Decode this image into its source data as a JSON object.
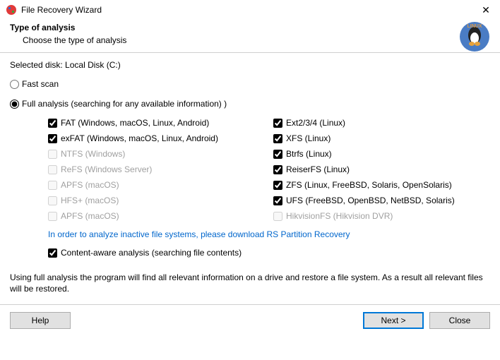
{
  "window": {
    "title": "File Recovery Wizard",
    "close_glyph": "✕"
  },
  "header": {
    "title": "Type of analysis",
    "subtitle": "Choose the type of analysis"
  },
  "selected_disk_label": "Selected disk: Local Disk (C:)",
  "scan_modes": {
    "fast_label": "Fast scan",
    "full_label": "Full analysis (searching for any available information)   )"
  },
  "filesystems": {
    "left": [
      {
        "label": "FAT (Windows, macOS, Linux, Android)",
        "checked": true,
        "disabled": false
      },
      {
        "label": "exFAT (Windows, macOS, Linux, Android)",
        "checked": true,
        "disabled": false
      },
      {
        "label": "NTFS (Windows)",
        "checked": false,
        "disabled": true
      },
      {
        "label": "ReFS (Windows Server)",
        "checked": false,
        "disabled": true
      },
      {
        "label": "APFS (macOS)",
        "checked": false,
        "disabled": true
      },
      {
        "label": "HFS+ (macOS)",
        "checked": false,
        "disabled": true
      },
      {
        "label": "APFS (macOS)",
        "checked": false,
        "disabled": true
      }
    ],
    "right": [
      {
        "label": "Ext2/3/4 (Linux)",
        "checked": true,
        "disabled": false
      },
      {
        "label": "XFS (Linux)",
        "checked": true,
        "disabled": false
      },
      {
        "label": "Btrfs (Linux)",
        "checked": true,
        "disabled": false
      },
      {
        "label": "ReiserFS (Linux)",
        "checked": true,
        "disabled": false
      },
      {
        "label": "ZFS (Linux, FreeBSD, Solaris, OpenSolaris)",
        "checked": true,
        "disabled": false
      },
      {
        "label": "UFS (FreeBSD, OpenBSD, NetBSD, Solaris)",
        "checked": true,
        "disabled": false
      },
      {
        "label": "HikvisionFS (Hikvision DVR)",
        "checked": false,
        "disabled": true
      }
    ]
  },
  "hint_link": "In order to analyze inactive file systems, please download RS Partition Recovery",
  "content_aware_label": "Content-aware analysis (searching file contents)",
  "description": "Using full analysis the program will find all relevant information on a drive and restore a file system. As a result all relevant files will be restored.",
  "buttons": {
    "help": "Help",
    "next": "Next >",
    "close": "Close"
  }
}
